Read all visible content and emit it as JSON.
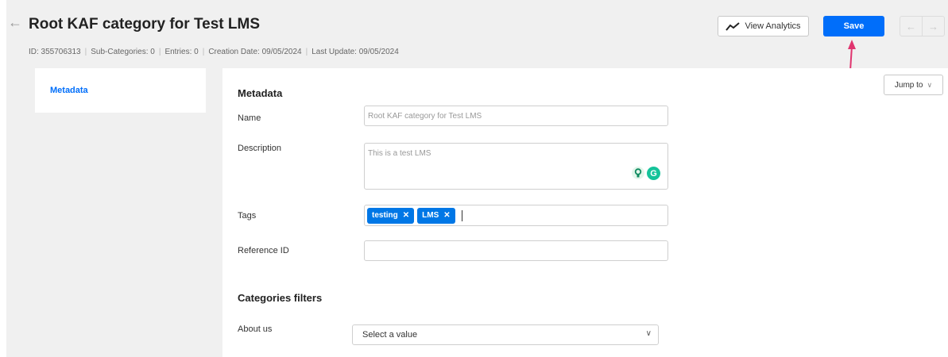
{
  "header": {
    "back_icon": "back-arrow-icon",
    "title": "Root KAF category for Test LMS",
    "meta": {
      "id": "ID: 355706313",
      "sub_categories": "Sub-Categories: 0",
      "entries": "Entries: 0",
      "creation_date": "Creation Date: 09/05/2024",
      "last_update": "Last Update: 09/05/2024"
    },
    "view_analytics_label": "View Analytics",
    "save_label": "Save",
    "prev_icon": "←",
    "next_icon": "→"
  },
  "sidebar": {
    "items": [
      {
        "label": "Metadata"
      }
    ]
  },
  "jump_to_label": "Jump to",
  "form": {
    "metadata_title": "Metadata",
    "name_label": "Name",
    "name_value": "Root KAF category for Test LMS",
    "description_label": "Description",
    "description_value": "This is a test LMS",
    "tags_label": "Tags",
    "tags": [
      "testing",
      "LMS"
    ],
    "reference_id_label": "Reference ID",
    "reference_id_value": "",
    "categories_filters_title": "Categories filters",
    "about_us_label": "About us",
    "about_us_value": "Select a value"
  },
  "colors": {
    "accent": "#006efa",
    "tag": "#0077e6",
    "annotation": "#e0356f"
  }
}
